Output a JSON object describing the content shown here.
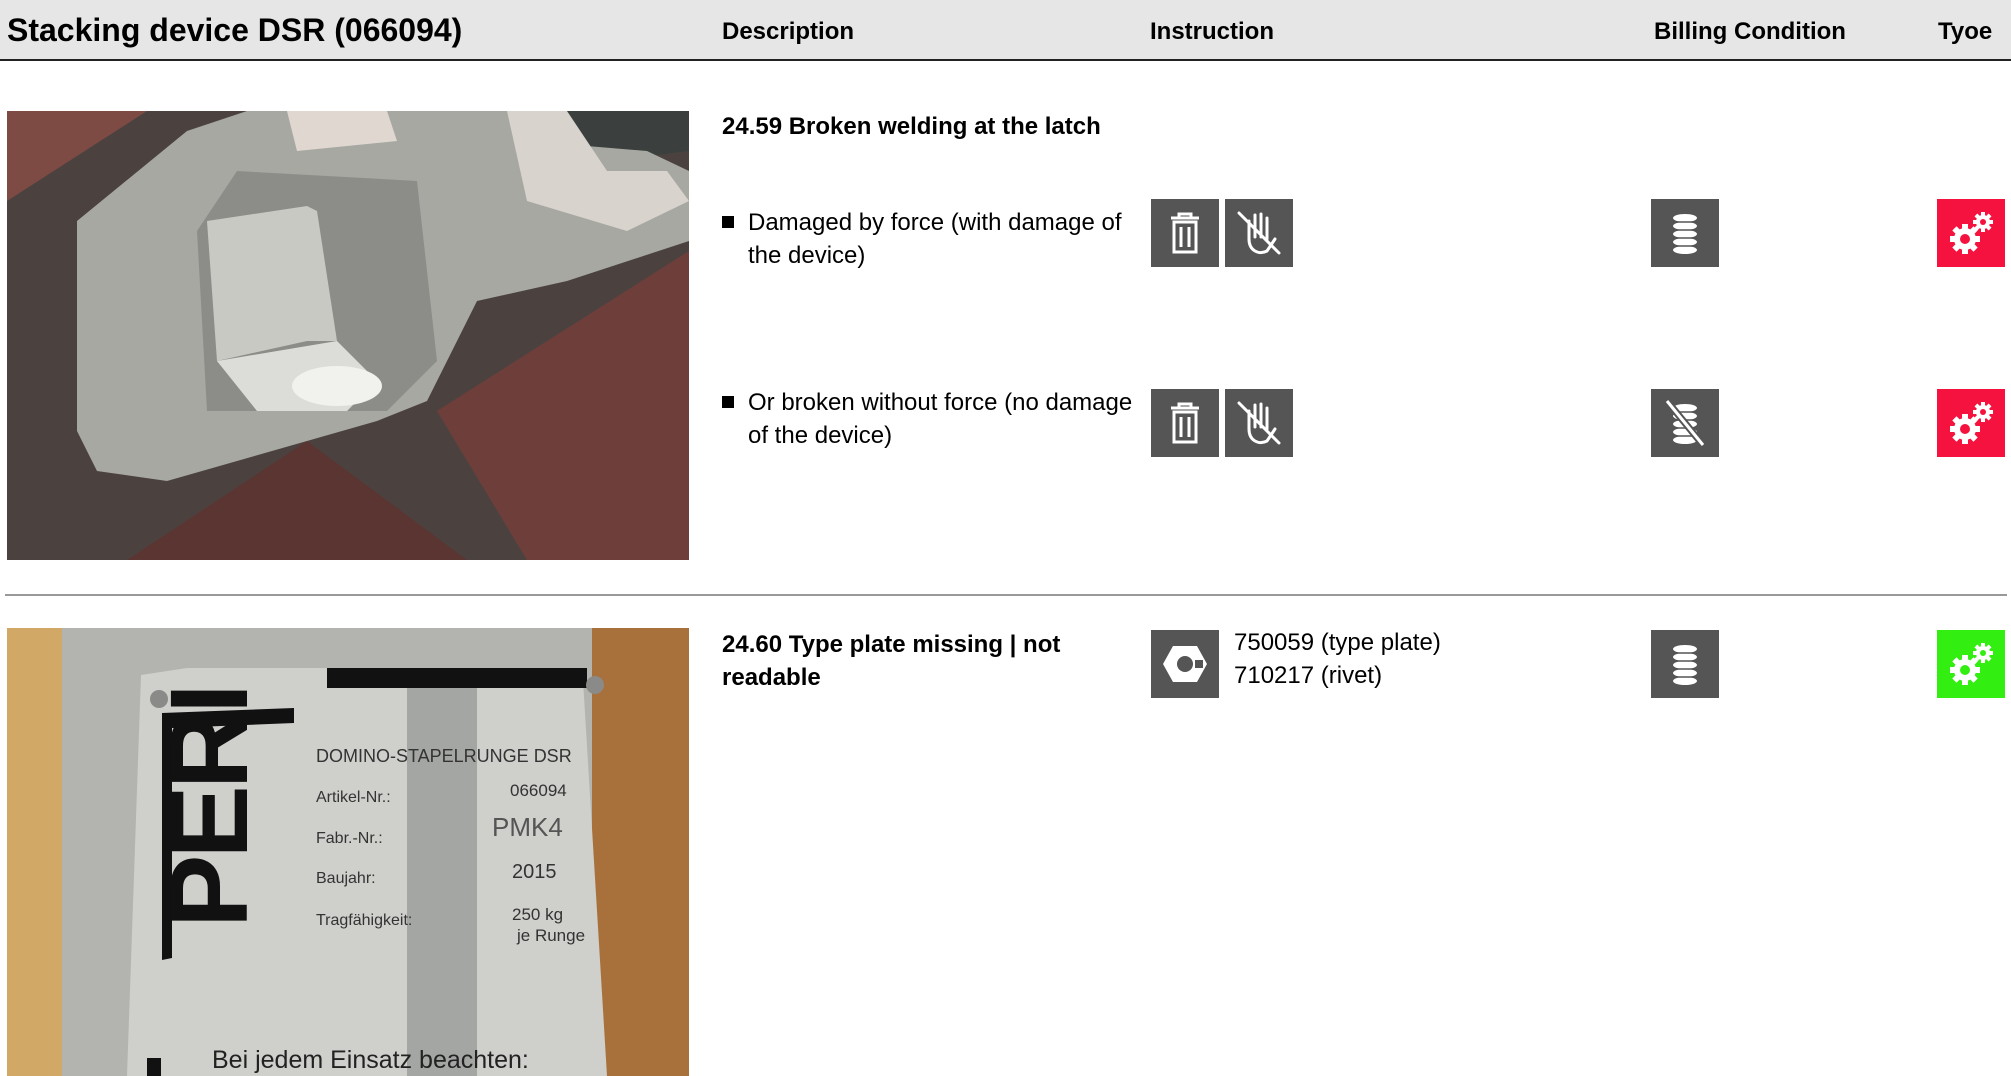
{
  "header": {
    "title": "Stacking device DSR (066094)",
    "columns": {
      "description": "Description",
      "instruction": "Instruction",
      "billing": "Billing Condition",
      "type": "Tyoe"
    }
  },
  "sections": [
    {
      "title": "24.59 Broken welding at the latch",
      "items": [
        {
          "text": "Damaged by force (with damage of the device)",
          "instruction_icons": [
            "trash-icon",
            "no-touch-hand-icon"
          ],
          "billing_icon": "coins-icon",
          "type_icon": "gears-icon",
          "type_color": "#f5123f"
        },
        {
          "text": "Or broken without force (no damage of the device)",
          "instruction_icons": [
            "trash-icon",
            "no-touch-hand-icon"
          ],
          "billing_icon": "no-coins-icon",
          "type_icon": "gears-icon",
          "type_color": "#f5123f"
        }
      ]
    },
    {
      "title": "24.60 Type plate missing | not readable",
      "instruction_icon": "hex-nut-icon",
      "instruction_lines": [
        "750059 (type plate)",
        "710217 (rivet)"
      ],
      "billing_icon": "coins-icon",
      "type_icon": "gears-icon",
      "type_color": "#33ee11"
    }
  ],
  "type_plate": {
    "brand": "PERI",
    "product": "DOMINO-STAPELRUNGE DSR",
    "fields": [
      {
        "label": "Artikel-Nr.:",
        "value": "066094"
      },
      {
        "label": "Fabr.-Nr.:",
        "value": "PMK4"
      },
      {
        "label": "Baujahr:",
        "value": "2015"
      },
      {
        "label": "Tragfähigkeit:",
        "value": "250 kg"
      }
    ],
    "capacity_note": "je Runge",
    "footer": "Bei jedem Einsatz beachten:"
  }
}
